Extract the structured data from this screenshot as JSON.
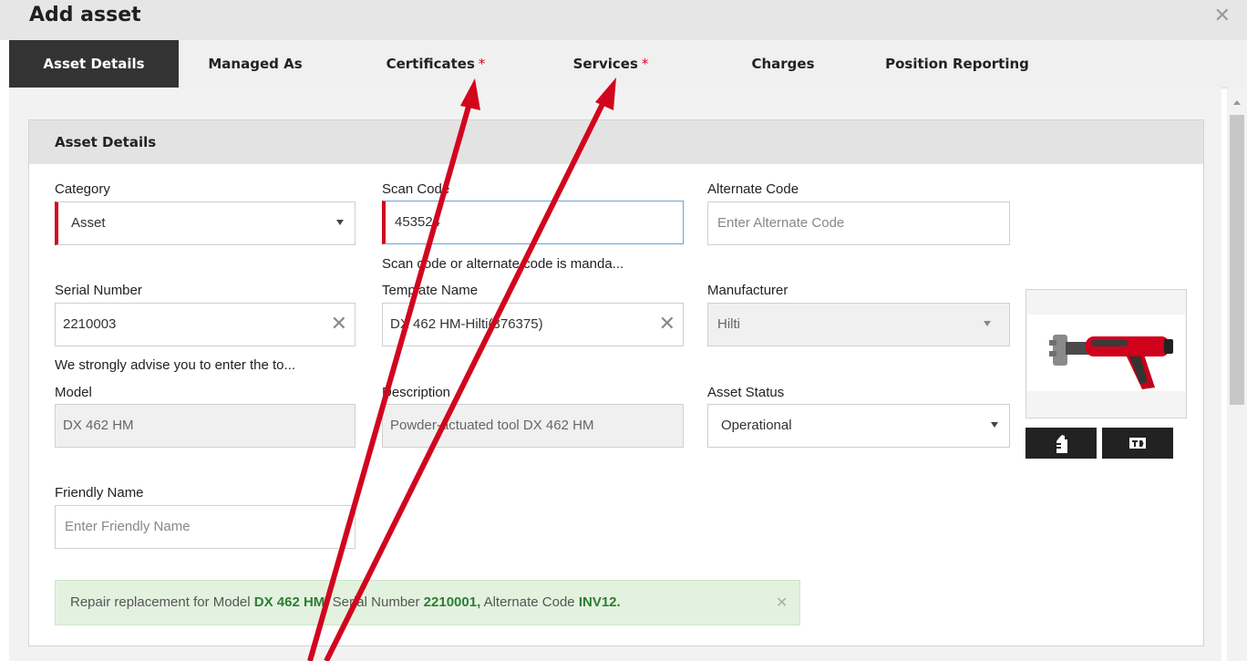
{
  "dialog": {
    "title": "Add asset",
    "close_symbol": "✕"
  },
  "tabs": [
    {
      "label": "Asset Details",
      "required": false
    },
    {
      "label": "Managed As",
      "required": false
    },
    {
      "label": "Certificates",
      "required": true
    },
    {
      "label": "Services",
      "required": true
    },
    {
      "label": "Charges",
      "required": false
    },
    {
      "label": "Position Reporting",
      "required": false
    }
  ],
  "required_mark": "*",
  "panel": {
    "title": "Asset Details",
    "category": {
      "label": "Category",
      "value": "Asset"
    },
    "scan_code": {
      "label": "Scan Code",
      "value": "453524",
      "note": "Scan code or alternate code is manda..."
    },
    "alternate_code": {
      "label": "Alternate Code",
      "placeholder": "Enter Alternate Code"
    },
    "serial_number": {
      "label": "Serial Number",
      "value": "2210003",
      "note": "We strongly advise you to enter the to..."
    },
    "template_name": {
      "label": "Template Name",
      "value": "DX 462 HM-Hilti(376375)"
    },
    "manufacturer": {
      "label": "Manufacturer",
      "value": "Hilti"
    },
    "model": {
      "label": "Model",
      "value": "DX 462 HM"
    },
    "description": {
      "label": "Description",
      "value": "Powder-actuated tool DX 462 HM"
    },
    "asset_status": {
      "label": "Asset Status",
      "value": "Operational"
    },
    "friendly_name": {
      "label": "Friendly Name",
      "placeholder": "Enter Friendly Name"
    },
    "clear_symbol": "✕"
  },
  "banner": {
    "prefix": "Repair replacement for Model ",
    "model": "DX 462 HM,",
    "serial_label": " Serial Number ",
    "serial": "2210001,",
    "alt_label": " Alternate Code ",
    "alt": "INV12.",
    "close_symbol": "✕"
  },
  "colors": {
    "accent_red": "#d2051e",
    "active_tab": "#333333",
    "banner_green": "#2e7d32",
    "arrow": "#d2051e"
  }
}
